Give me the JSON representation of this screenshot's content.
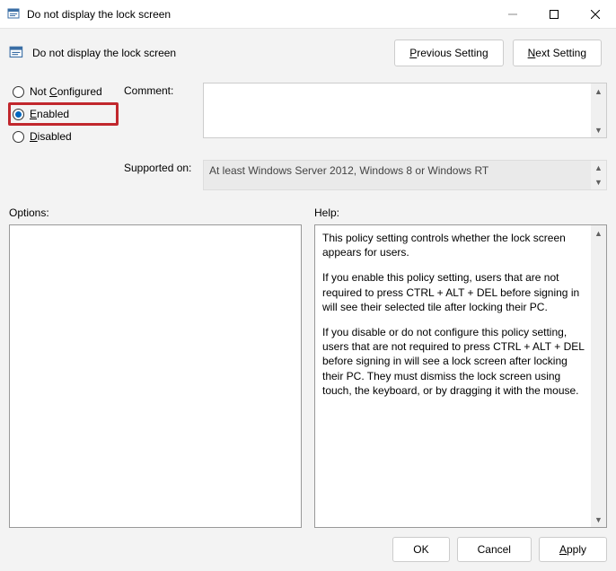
{
  "window": {
    "title": "Do not display the lock screen",
    "heading": "Do not display the lock screen"
  },
  "nav": {
    "prev": "Previous Setting",
    "next": "Next Setting",
    "prev_ul": "P",
    "next_ul": "N"
  },
  "radios": {
    "not_configured": "Not Configured",
    "not_configured_ul": "C",
    "enabled": "Enabled",
    "enabled_ul": "E",
    "disabled": "Disabled",
    "disabled_ul": "D",
    "selected": "enabled"
  },
  "labels": {
    "comment": "Comment:",
    "supported": "Supported on:",
    "options": "Options:",
    "help": "Help:"
  },
  "supported_text": "At least Windows Server 2012, Windows 8 or Windows RT",
  "help_paragraphs": [
    "This policy setting controls whether the lock screen appears for users.",
    "If you enable this policy setting, users that are not required to press CTRL + ALT + DEL before signing in will see their selected tile after locking their PC.",
    "If you disable or do not configure this policy setting, users that are not required to press CTRL + ALT + DEL before signing in will see a lock screen after locking their PC. They must dismiss the lock screen using touch, the keyboard, or by dragging it with the mouse."
  ],
  "footer": {
    "ok": "OK",
    "cancel": "Cancel",
    "apply": "Apply",
    "apply_ul": "A"
  }
}
